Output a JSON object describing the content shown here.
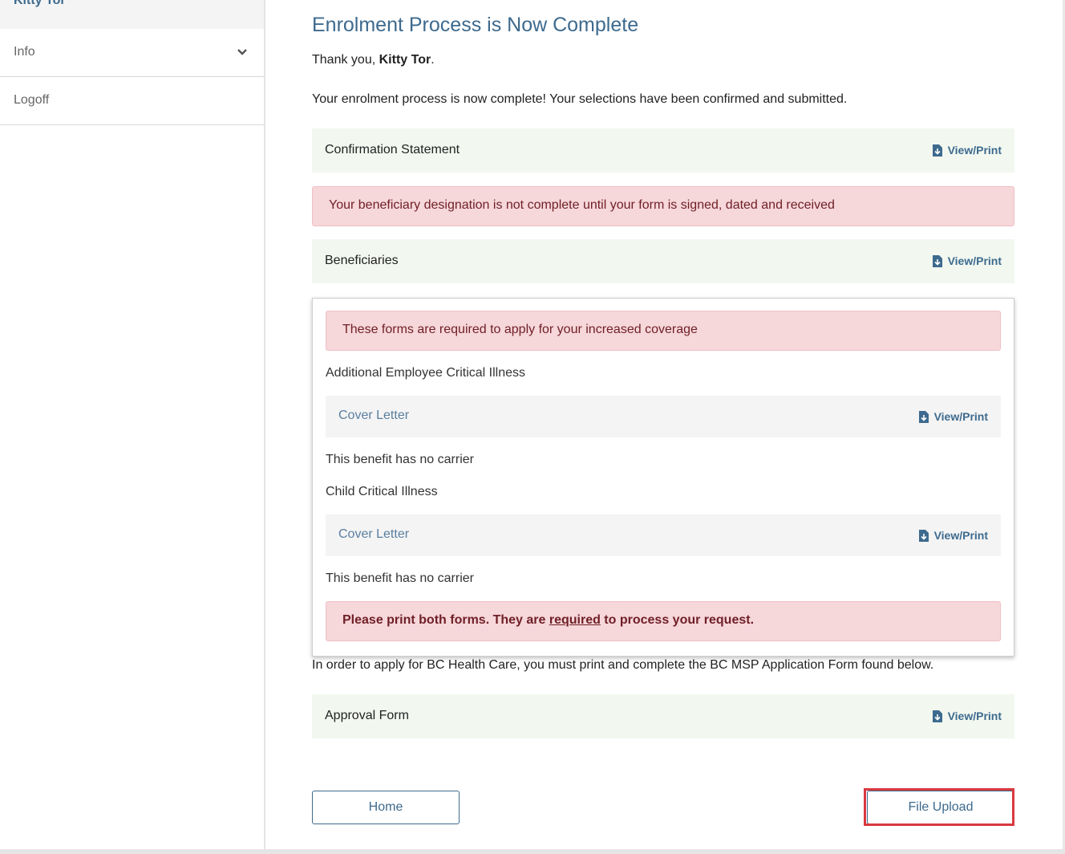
{
  "sidebar": {
    "user_name": "Kitty Tor",
    "items": [
      {
        "label": "Info",
        "icon": "chevron-down-icon"
      },
      {
        "label": "Logoff"
      }
    ]
  },
  "main": {
    "title": "Enrolment Process is Now Complete",
    "thank_prefix": "Thank you, ",
    "thank_name": "Kitty Tor",
    "thank_suffix": ".",
    "complete_text": "Your enrolment process is now complete! Your selections have been confirmed and submitted.",
    "view_print_label": "View/Print",
    "confirmation_label": "Confirmation Statement",
    "beneficiary_alert": "Your beneficiary designation is not complete until your form is signed, dated and received",
    "beneficiaries_label": "Beneficiaries",
    "forms_card": {
      "alert": "These forms are required to apply for your increased coverage",
      "sections": [
        {
          "title": "Additional Employee Critical Illness",
          "doc_label": "Cover Letter",
          "carrier_text": "This benefit has no carrier"
        },
        {
          "title": "Child Critical Illness",
          "doc_label": "Cover Letter",
          "carrier_text": "This benefit has no carrier"
        }
      ],
      "print_alert_prefix": "Please print both forms. They are ",
      "print_alert_link": "required",
      "print_alert_suffix": " to process your request."
    },
    "bc_text": "In order to apply for BC Health Care, you must print and complete the BC MSP Application Form found below.",
    "approval_label": "Approval Form",
    "home_button": "Home",
    "upload_button": "File Upload"
  },
  "colors": {
    "accent": "#3d6a8e",
    "success_bar": "#f2f8f0",
    "danger_bg": "#f6d7da",
    "danger_text": "#6f1f26",
    "highlight": "#d9393f"
  }
}
